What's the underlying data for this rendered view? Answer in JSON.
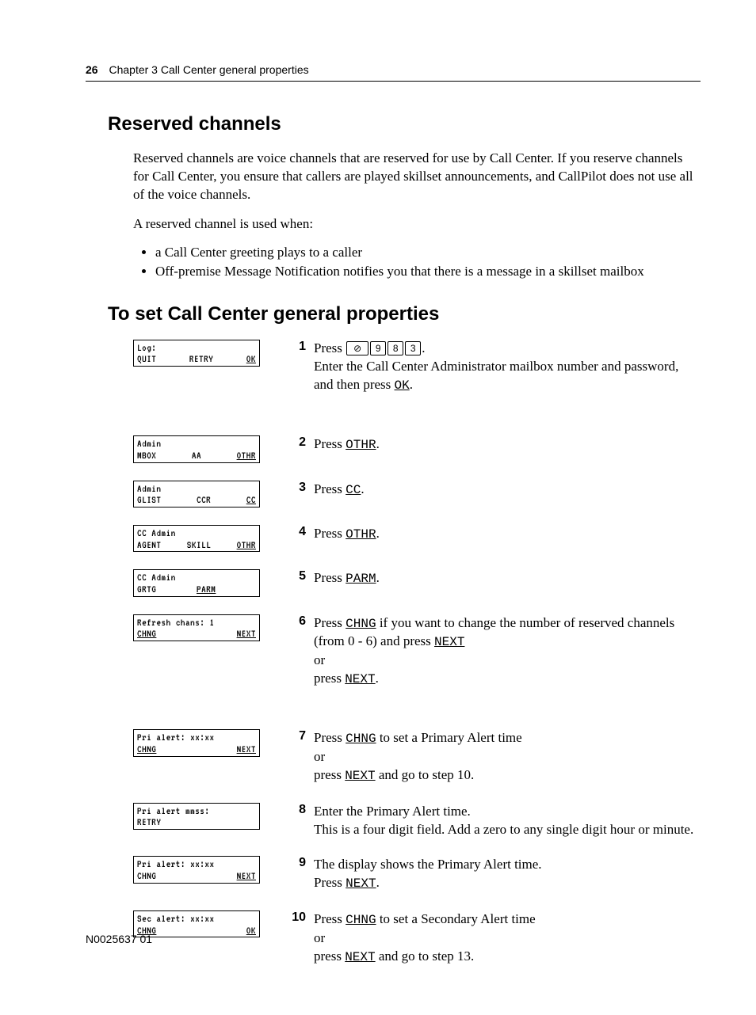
{
  "header": {
    "page_number": "26",
    "chapter": "Chapter 3  Call Center general properties"
  },
  "section1": {
    "title": "Reserved channels",
    "p1": "Reserved channels are voice channels that are reserved for use by Call Center. If you reserve channels for Call Center, you ensure that callers are played skillset announcements, and CallPilot does not use all of the voice channels.",
    "p2": "A reserved channel is used when:",
    "bullets": [
      "a Call Center greeting plays to a caller",
      "Off-premise Message Notification notifies you that there is a message in a skillset mailbox"
    ]
  },
  "section2": {
    "title": "To set Call Center general properties"
  },
  "lcd": {
    "s1": {
      "l1": "Log:",
      "a": "QUIT",
      "b": "RETRY",
      "c": "OK"
    },
    "s2": {
      "l1": "Admin",
      "a": "MBOX",
      "b": "AA",
      "c": "OTHR"
    },
    "s3": {
      "l1": "Admin",
      "a": "GLIST",
      "b": "CCR",
      "c": "CC"
    },
    "s4": {
      "l1": "CC Admin",
      "a": "AGENT",
      "b": "SKILL",
      "c": "OTHR"
    },
    "s5": {
      "l1": "CC Admin",
      "a": "GRTG",
      "b": "PARM",
      "c": ""
    },
    "s6": {
      "l1": "Refresh chans: 1",
      "a": "CHNG",
      "b": "",
      "c": "NEXT"
    },
    "s7": {
      "l1": "Pri alert: xx:xx",
      "a": "CHNG",
      "b": "",
      "c": "NEXT"
    },
    "s8": {
      "l1": "Pri alert mmss:",
      "a": "RETRY",
      "b": "",
      "c": ""
    },
    "s9": {
      "l1": "Pri alert: xx:xx",
      "a": "CHNG",
      "b": "",
      "c": "NEXT"
    },
    "s10": {
      "l1": "Sec alert: xx:xx",
      "a": "CHNG",
      "b": "",
      "c": "OK"
    }
  },
  "steps": {
    "s1": {
      "num": "1",
      "t0": "Press ",
      "k1": "⊘",
      "k2": "9",
      "k3": "8",
      "k4": "3",
      "t1": ".",
      "t2": "Enter the Call Center Administrator mailbox number and password, and then press ",
      "sk": "OK",
      "t3": "."
    },
    "s2": {
      "num": "2",
      "t0": "Press ",
      "sk": "OTHR",
      "t1": "."
    },
    "s3": {
      "num": "3",
      "t0": "Press ",
      "sk": "CC",
      "t1": "."
    },
    "s4": {
      "num": "4",
      "t0": "Press ",
      "sk": "OTHR",
      "t1": "."
    },
    "s5": {
      "num": "5",
      "t0": "Press ",
      "sk": "PARM",
      "t1": "."
    },
    "s6": {
      "num": "6",
      "t0": "Press ",
      "sk0": "CHNG",
      "t1": " if you want to change the number of reserved channels (from 0 - 6) and press ",
      "sk1": "NEXT",
      "t2": "or",
      "t3": "press ",
      "sk2": "NEXT",
      "t4": "."
    },
    "s7": {
      "num": "7",
      "t0": "Press ",
      "sk0": "CHNG",
      "t1": " to set a Primary Alert time",
      "t2": "or",
      "t3": "press ",
      "sk1": "NEXT",
      "t4": " and go to step 10."
    },
    "s8": {
      "num": "8",
      "t0": "Enter the Primary Alert time.",
      "t1": "This is a four digit field. Add a zero to any single digit hour or minute."
    },
    "s9": {
      "num": "9",
      "t0": "The display shows the Primary Alert time.",
      "t1": "Press ",
      "sk": "NEXT",
      "t2": "."
    },
    "s10": {
      "num": "10",
      "t0": "Press ",
      "sk0": "CHNG",
      "t1": " to set a Secondary Alert time",
      "t2": "or",
      "t3": "press ",
      "sk1": "NEXT",
      "t4": " and go to step 13."
    }
  },
  "footer": {
    "docnum": "N0025637 01"
  }
}
